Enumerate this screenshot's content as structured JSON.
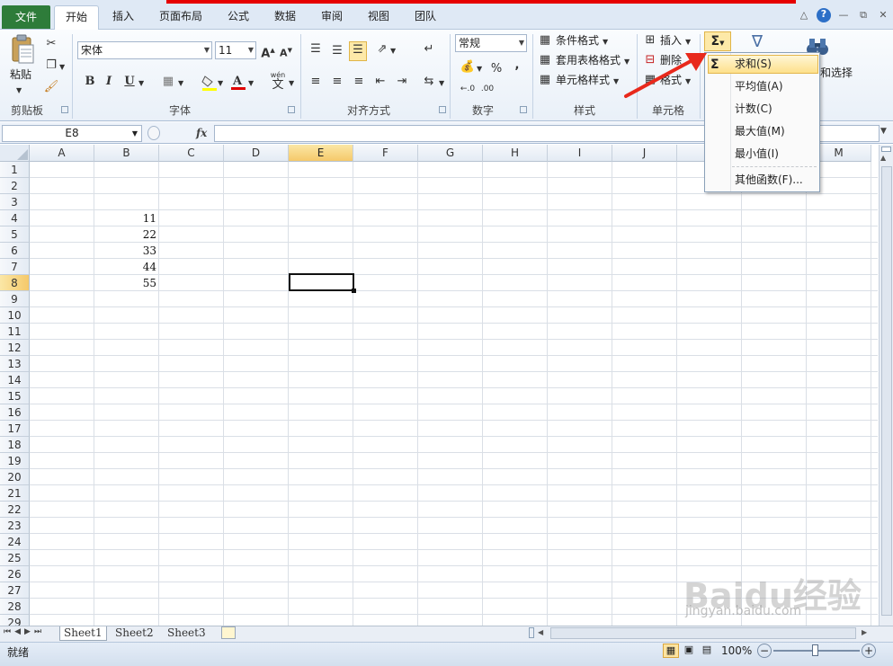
{
  "tabs": [
    "文件",
    "开始",
    "插入",
    "页面布局",
    "公式",
    "数据",
    "审阅",
    "视图",
    "团队"
  ],
  "clipboard": {
    "paste": "粘贴",
    "group": "剪贴板"
  },
  "font": {
    "name": "宋体",
    "size": "11",
    "group": "字体",
    "bold": "B",
    "italic": "I",
    "underline": "U",
    "wen": "wén",
    "wen_char": "文"
  },
  "alignment": {
    "group": "对齐方式"
  },
  "number": {
    "format": "常规",
    "percent": "%",
    "comma": ",",
    "group": "数字"
  },
  "styles": {
    "conditional": "条件格式",
    "table": "套用表格格式",
    "cell": "单元格样式",
    "group": "样式"
  },
  "cells": {
    "insert": "插入",
    "delete": "删除",
    "format": "格式",
    "group": "单元格"
  },
  "editing": {
    "find_select": "和选择"
  },
  "formula_bar": {
    "name_box": "E8",
    "fx": "fx",
    "value": ""
  },
  "columns": [
    "A",
    "B",
    "C",
    "D",
    "E",
    "F",
    "G",
    "H",
    "I",
    "J",
    "K",
    "L",
    "M"
  ],
  "rows": [
    "1",
    "2",
    "3",
    "4",
    "5",
    "6",
    "7",
    "8",
    "9",
    "10",
    "11",
    "12",
    "13",
    "14",
    "15",
    "16",
    "17",
    "18",
    "19",
    "20",
    "21",
    "22",
    "23",
    "24",
    "25",
    "26",
    "27",
    "28",
    "29"
  ],
  "cell_values": {
    "B4": "11",
    "B5": "22",
    "B6": "33",
    "B7": "44",
    "B8": "55"
  },
  "autosum_menu": {
    "sigma": "Σ",
    "items": [
      "求和(S)",
      "平均值(A)",
      "计数(C)",
      "最大值(M)",
      "最小值(I)",
      "其他函数(F)..."
    ]
  },
  "sheets": [
    "Sheet1",
    "Sheet2",
    "Sheet3"
  ],
  "status": {
    "ready": "就绪",
    "zoom": "100%",
    "minus": "−",
    "plus": "+"
  },
  "watermark": {
    "brand": "Baidu经验",
    "url": "jingyan.baidu.com"
  },
  "colors": {
    "file_tab": "#2e7c3a",
    "selected_header": "#f5c96a",
    "arrow": "#e8291c"
  }
}
